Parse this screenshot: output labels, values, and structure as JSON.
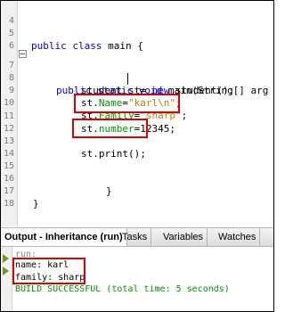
{
  "editor": {
    "lines": [
      {
        "num": "4",
        "text": ""
      },
      {
        "num": "5",
        "kw1": "public class",
        "rest": " main {"
      },
      {
        "num": "6",
        "text": ""
      },
      {
        "num": "7",
        "kw1": "public static void",
        "rest": " main(String[] arg"
      },
      {
        "num": "8",
        "text": "student st= ",
        "kw": "new",
        "after": " student();"
      },
      {
        "num": "9",
        "pre": "st.",
        "field": "Name",
        "mid": "=",
        "string": "\"karl\\n\"",
        "post": ";"
      },
      {
        "num": "10",
        "pre": "st.",
        "field": "Family",
        "mid": "=",
        "string": "\"sharp\"",
        "post": ";"
      },
      {
        "num": "11",
        "pre": "st.",
        "field": "number",
        "mid": "=12345;",
        "string": "",
        "post": ""
      },
      {
        "num": "12",
        "text": ""
      },
      {
        "num": "13",
        "text": "st.print();"
      },
      {
        "num": "14",
        "text": ""
      },
      {
        "num": "15",
        "text": ""
      },
      {
        "num": "16",
        "text": "}"
      },
      {
        "num": "17",
        "text": "}"
      },
      {
        "num": "18",
        "text": ""
      }
    ]
  },
  "tabs": [
    {
      "label": "Output - Inheritance (run)",
      "active": true
    },
    {
      "label": "Tasks",
      "active": false
    },
    {
      "label": "Variables",
      "active": false
    },
    {
      "label": "Watches",
      "active": false
    }
  ],
  "output": {
    "run_label": "run:",
    "line1": "name: karl",
    "line2": "family: sharp",
    "build": "BUILD SUCCESSFUL (total time: 5 seconds)"
  },
  "colors": {
    "highlight_box": "#e00000",
    "keyword": "#0000e6",
    "field": "#009900",
    "string": "#ce7b00"
  }
}
